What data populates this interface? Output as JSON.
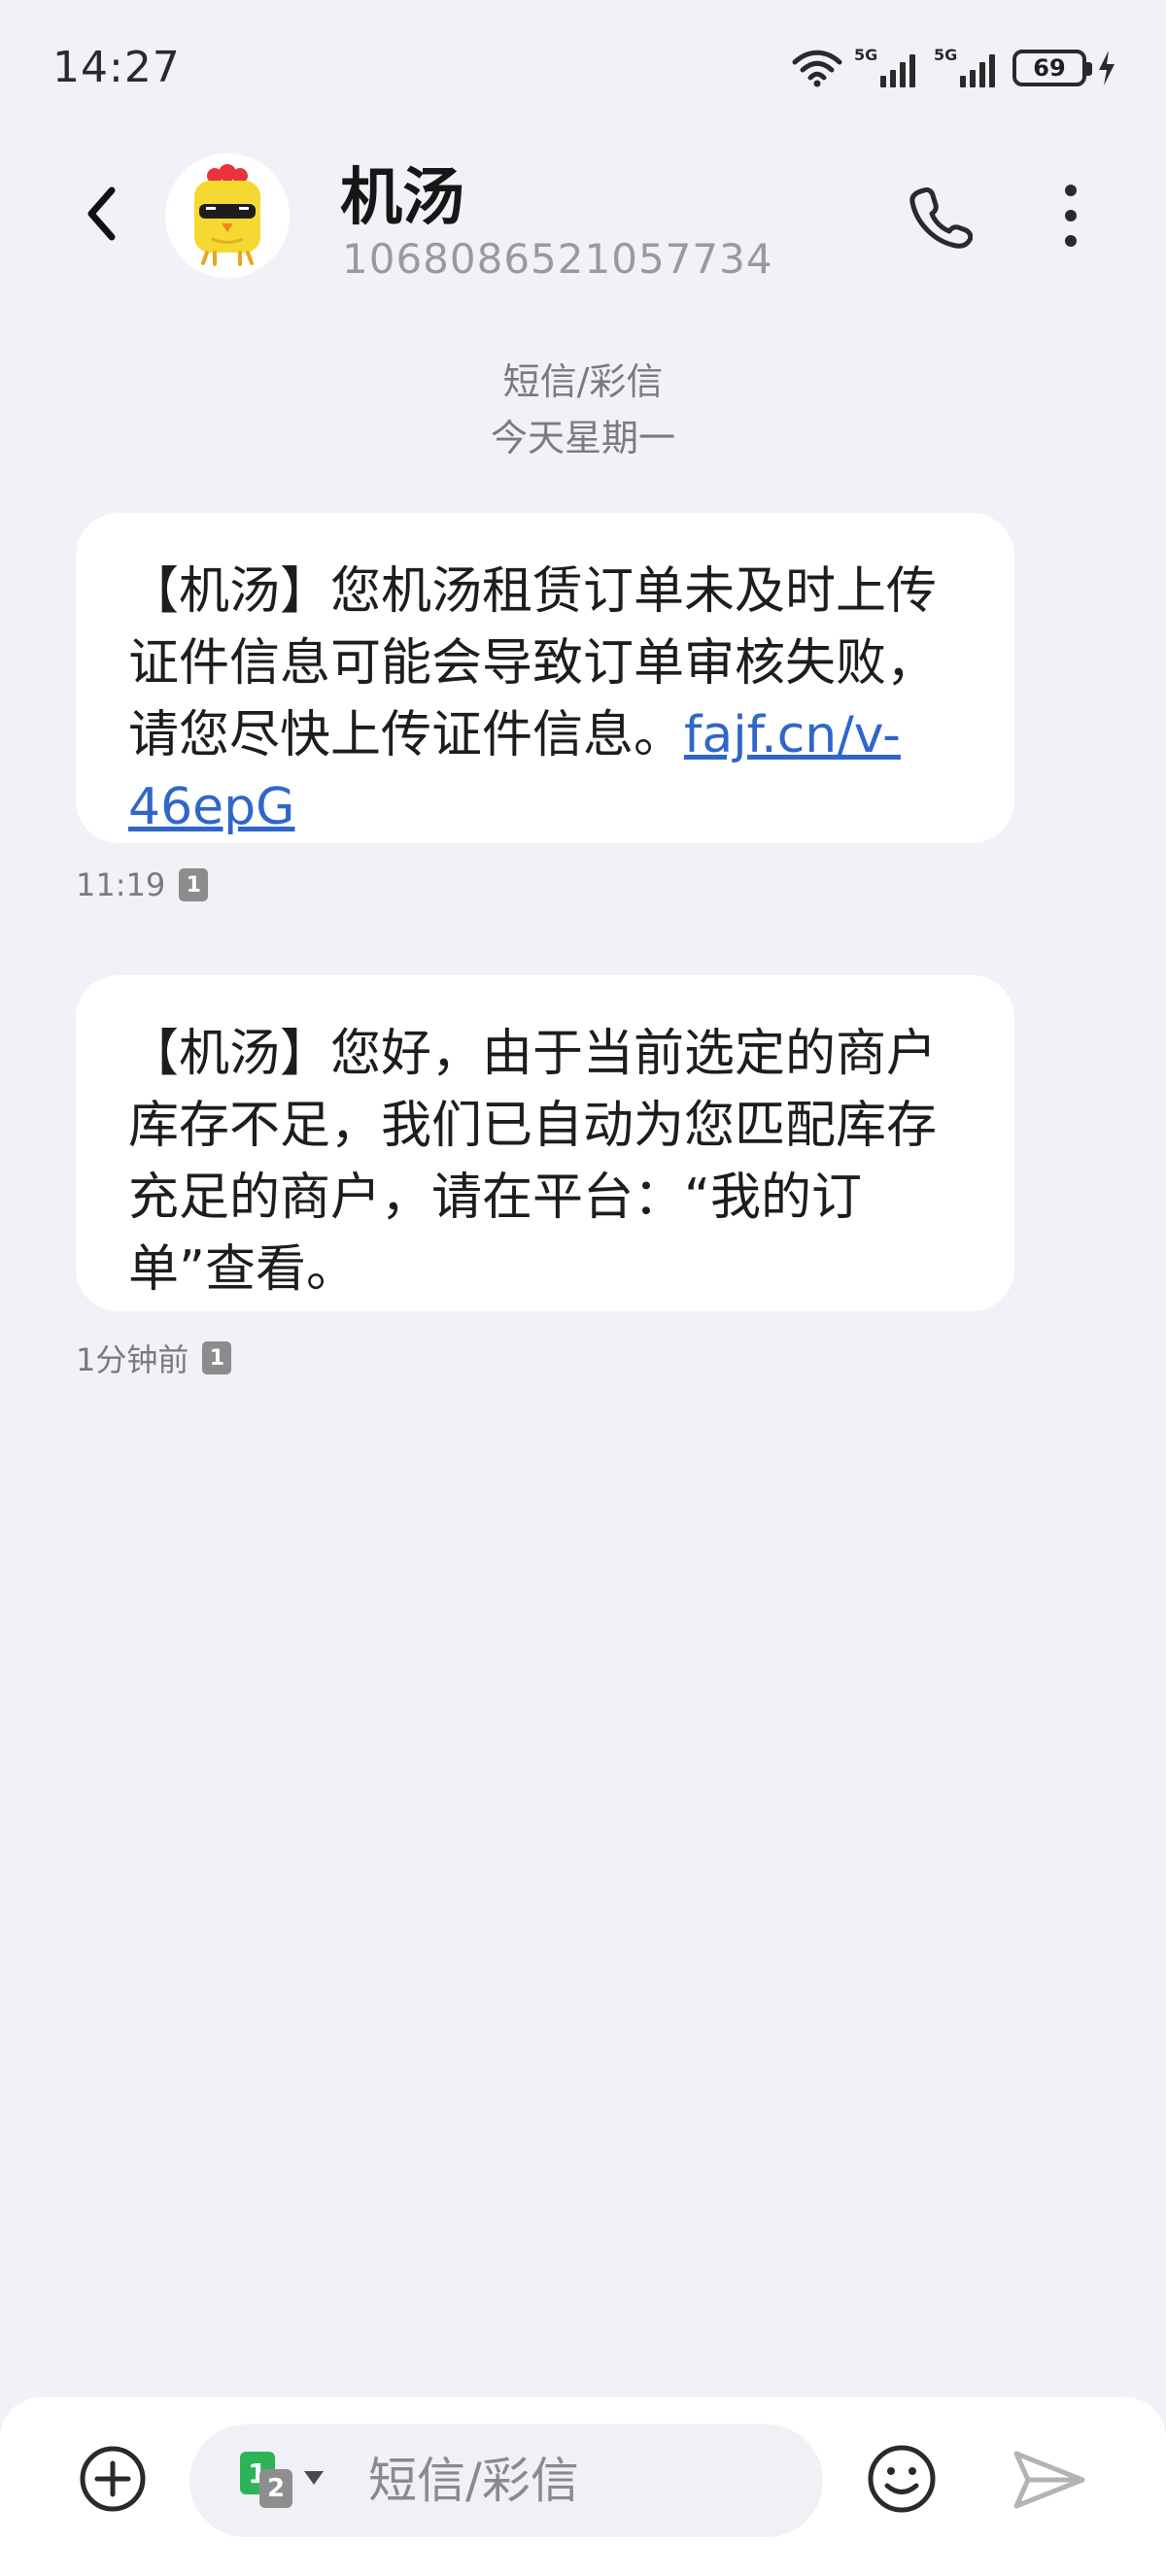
{
  "status_bar": {
    "time": "14:27",
    "network_1": "5G",
    "network_2": "5G",
    "battery": "69"
  },
  "conversation": {
    "contact_name": "机汤",
    "contact_number": "1068086521057734",
    "message_type_label": "短信/彩信",
    "date_label": "今天星期一"
  },
  "messages": [
    {
      "text": "【机汤】您机汤租赁订单未及时上传证件信息可能会导致订单审核失败，请您尽快上传证件信息。",
      "link": "fajf.cn/v-46epG",
      "time": "11:19",
      "sim": "1"
    },
    {
      "text": "【机汤】您好，由于当前选定的商户库存不足，我们已自动为您匹配库存充足的商户，请在平台：“我的订单”查看。",
      "time": "1分钟前",
      "sim": "1"
    }
  ],
  "composer": {
    "placeholder": "短信/彩信",
    "sim_primary": "1",
    "sim_secondary": "2"
  },
  "icons": {
    "back": "chevron-left-icon",
    "call": "phone-icon",
    "more": "more-vertical-icon",
    "add": "plus-circle-icon",
    "emoji": "smile-icon",
    "send": "send-icon"
  },
  "colors": {
    "background": "#f1f2f7",
    "bubble": "#ffffff",
    "link": "#2f66c9",
    "sim_green": "#2db457"
  }
}
